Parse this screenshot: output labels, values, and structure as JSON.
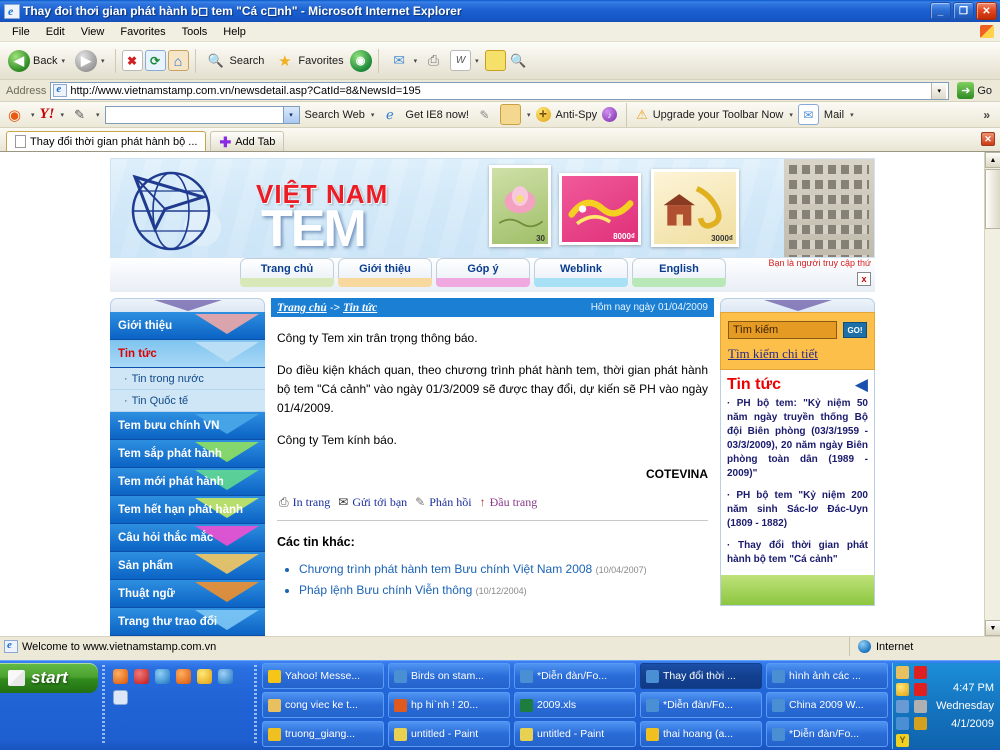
{
  "window": {
    "title": "Thay đoi thơi gian phát hành b◻ tem \"Cá c◻nh\" - Microsoft Internet Explorer",
    "minimize": "_",
    "maximize": "❐",
    "close": "✕"
  },
  "menubar": {
    "items": [
      "File",
      "Edit",
      "View",
      "Favorites",
      "Tools",
      "Help"
    ]
  },
  "toolbar": {
    "back": "Back",
    "back_arrow": "◀",
    "forward_arrow": "▶",
    "stop": "✖",
    "refresh": "⟳",
    "home": "⌂",
    "search": "Search",
    "favorites": "Favorites",
    "media": "◉",
    "mail": "✉",
    "print": "⎙",
    "word": "W",
    "notes": "▭",
    "discuss": "🔍",
    "dropdown": "▾"
  },
  "address": {
    "label": "Address",
    "url": "http://www.vietnamstamp.com.vn/newsdetail.asp?CatId=8&NewsId=195",
    "go": "Go",
    "go_arrow": "➜",
    "dropdown": "▾"
  },
  "yahoo_toolbar": {
    "logo": "Y!",
    "search_value": "",
    "search_web": "Search Web",
    "get_ie8": "Get IE8 now!",
    "anti_spy": "Anti-Spy",
    "upgrade": "Upgrade your Toolbar Now",
    "mail": "Mail",
    "overflow": "»",
    "dropdown": "▾"
  },
  "tabs": {
    "items": [
      {
        "label": "Thay đổi thời gian phát hành bộ ..."
      }
    ],
    "add_tab": "Add Tab",
    "close": "✕"
  },
  "site": {
    "logo": {
      "vietnam": "VIỆT NAM",
      "tem": "TEM"
    },
    "stamps": [
      {
        "name": "lotus-stamp",
        "value": "30"
      },
      {
        "name": "dragon-stamp",
        "value": "8000₫"
      },
      {
        "name": "temple-stamp",
        "value": "3000₫"
      }
    ],
    "nav": [
      {
        "label": "Trang chủ",
        "color": "#d9e8b8"
      },
      {
        "label": "Giới thiệu",
        "color": "#f7d9a0"
      },
      {
        "label": "Góp ý",
        "color": "#f0a8e0"
      },
      {
        "label": "Weblink",
        "color": "#a8e0f5"
      },
      {
        "label": "English",
        "color": "#b8e8b8"
      }
    ],
    "visitor_text": "Bạn là người truy cập thứ",
    "visitor_close": "x",
    "sidebar": [
      {
        "label": "Giới thiệu",
        "type": "main",
        "active": false
      },
      {
        "label": "Tin tức",
        "type": "main",
        "active": true
      },
      {
        "label": "Tin trong nước",
        "type": "sub"
      },
      {
        "label": "Tin Quốc tế",
        "type": "sub"
      },
      {
        "label": "Tem bưu chính VN",
        "type": "main",
        "active": false
      },
      {
        "label": "Tem sắp phát hành",
        "type": "main",
        "active": false
      },
      {
        "label": "Tem mới phát hành",
        "type": "main",
        "active": false
      },
      {
        "label": "Tem hết hạn phát hành",
        "type": "main",
        "active": false
      },
      {
        "label": "Câu hỏi thắc mắc",
        "type": "main",
        "active": false
      },
      {
        "label": "Sản phẩm",
        "type": "main",
        "active": false
      },
      {
        "label": "Thuật ngữ",
        "type": "main",
        "active": false
      },
      {
        "label": "Trang thư trao đổi",
        "type": "main",
        "active": false
      }
    ],
    "breadcrumb": {
      "home": "Trang chủ",
      "sep": "->",
      "current": "Tin tức"
    },
    "today": "Hôm nay ngày 01/04/2009",
    "article": {
      "paragraphs": [
        "Công ty Tem xin trân trọng thông báo.",
        "Do điều kiện khách quan, theo chương trình phát hành tem, thời gian phát hành bộ tem \"Cá cảnh\" vào ngày 01/3/2009 sẽ được thay đổi, dự kiến sẽ PH vào ngày 01/4/2009.",
        "Công ty Tem kính báo."
      ],
      "signature": "COTEVINA"
    },
    "actions": [
      {
        "icon": "⎙",
        "label": "In trang",
        "name": "print-page-link"
      },
      {
        "icon": "✉",
        "label": "Gửi tới bạn",
        "name": "send-to-friend-link"
      },
      {
        "icon": "✎",
        "label": "Phản hồi",
        "name": "feedback-link"
      },
      {
        "icon": "↑",
        "label": "Đầu trang",
        "name": "back-to-top-link"
      }
    ],
    "other_news_title": "Các tin khác:",
    "other_news": [
      {
        "label": "Chương trình phát hành tem Bưu chính Việt Nam 2008",
        "date": "(10/04/2007)"
      },
      {
        "label": "Pháp lệnh Bưu chính Viễn thông",
        "date": "(10/12/2004)"
      }
    ],
    "search": {
      "value": "Tìm kiếm",
      "go": "GO!",
      "detail_link": "Tìm kiếm chi tiết"
    },
    "news_panel": {
      "title": "Tin tức",
      "arrow": "◀",
      "items": [
        "· PH bộ tem: \"Kỷ niệm 50 năm ngày truyền thống Bộ đội Biên phòng (03/3/1959 - 03/3/2009), 20 năm ngày Biên phòng toàn dân (1989 - 2009)\"",
        "· PH bộ tem \"Kỷ niệm 200 năm sinh Sác-lơ Đác-Uyn (1809 - 1882)",
        "· Thay đổi thời gian phát hành bộ tem \"Cá cảnh\""
      ]
    }
  },
  "statusbar": {
    "text": "Welcome to www.vietnamstamp.com.vn",
    "zone": "Internet"
  },
  "taskbar": {
    "start": "start",
    "quick_launch": [
      {
        "name": "firefox-icon",
        "color": "#e8701a"
      },
      {
        "name": "opera-icon",
        "color": "#d42a2a"
      },
      {
        "name": "media-icon",
        "color": "#3aa0e0"
      },
      {
        "name": "realplayer-icon",
        "color": "#e86a10"
      },
      {
        "name": "yahoo-messenger-icon",
        "color": "#f0c020"
      },
      {
        "name": "internet-explorer-icon",
        "color": "#2a7ad4"
      },
      {
        "name": "document-icon",
        "color": "#c8d8ee"
      }
    ],
    "tasks": [
      {
        "label": "Yahoo! Messe...",
        "icon": "#f5c518",
        "active": false
      },
      {
        "label": "Birds on stam...",
        "icon": "#4a8fd4",
        "active": false
      },
      {
        "label": "*Diễn đàn/Fo...",
        "icon": "#4a8fd4",
        "active": false
      },
      {
        "label": "Thay đổi thời ...",
        "icon": "#4a8fd4",
        "active": true
      },
      {
        "label": "hình ảnh các ...",
        "icon": "#4a8fd4",
        "active": false
      },
      {
        "label": "cong viec ke t...",
        "icon": "#e8c060",
        "active": false
      },
      {
        "label": "hp hi`nh ! 20...",
        "icon": "#e05a20",
        "active": false
      },
      {
        "label": "2009.xls",
        "icon": "#1d7d3f",
        "active": false
      },
      {
        "label": "*Diễn đàn/Fo...",
        "icon": "#4a8fd4",
        "active": false
      },
      {
        "label": "China 2009 W...",
        "icon": "#4a8fd4",
        "active": false
      },
      {
        "label": "truong_giang...",
        "icon": "#f0c020",
        "active": false
      },
      {
        "label": "untitled - Paint",
        "icon": "#e8d050",
        "active": false
      },
      {
        "label": "untitled - Paint",
        "icon": "#e8d050",
        "active": false
      },
      {
        "label": "thai hoang (a...",
        "icon": "#f0c020",
        "active": false
      },
      {
        "label": "*Diễn đàn/Fo...",
        "icon": "#4a8fd4",
        "active": false
      }
    ],
    "tray": [
      {
        "name": "folder-tray-icon",
        "color": "#e8c060"
      },
      {
        "name": "norton-tray-icon",
        "color": "#e02020"
      },
      {
        "name": "smiley-tray-icon",
        "color": "#f0c020"
      },
      {
        "name": "health-tray-icon",
        "color": "#e02020"
      },
      {
        "name": "network-tray-icon",
        "color": "#6a9ad4"
      },
      {
        "name": "shield-tray-icon",
        "color": "#b0b0b0"
      },
      {
        "name": "updates-tray-icon",
        "color": "#4a8fd4"
      },
      {
        "name": "sound-tray-icon",
        "color": "#d4a020"
      },
      {
        "name": "yahoo-tray-icon",
        "color": "#f0d020"
      }
    ],
    "clock": {
      "time": "4:47 PM",
      "day": "Wednesday",
      "date": "4/1/2009"
    }
  }
}
